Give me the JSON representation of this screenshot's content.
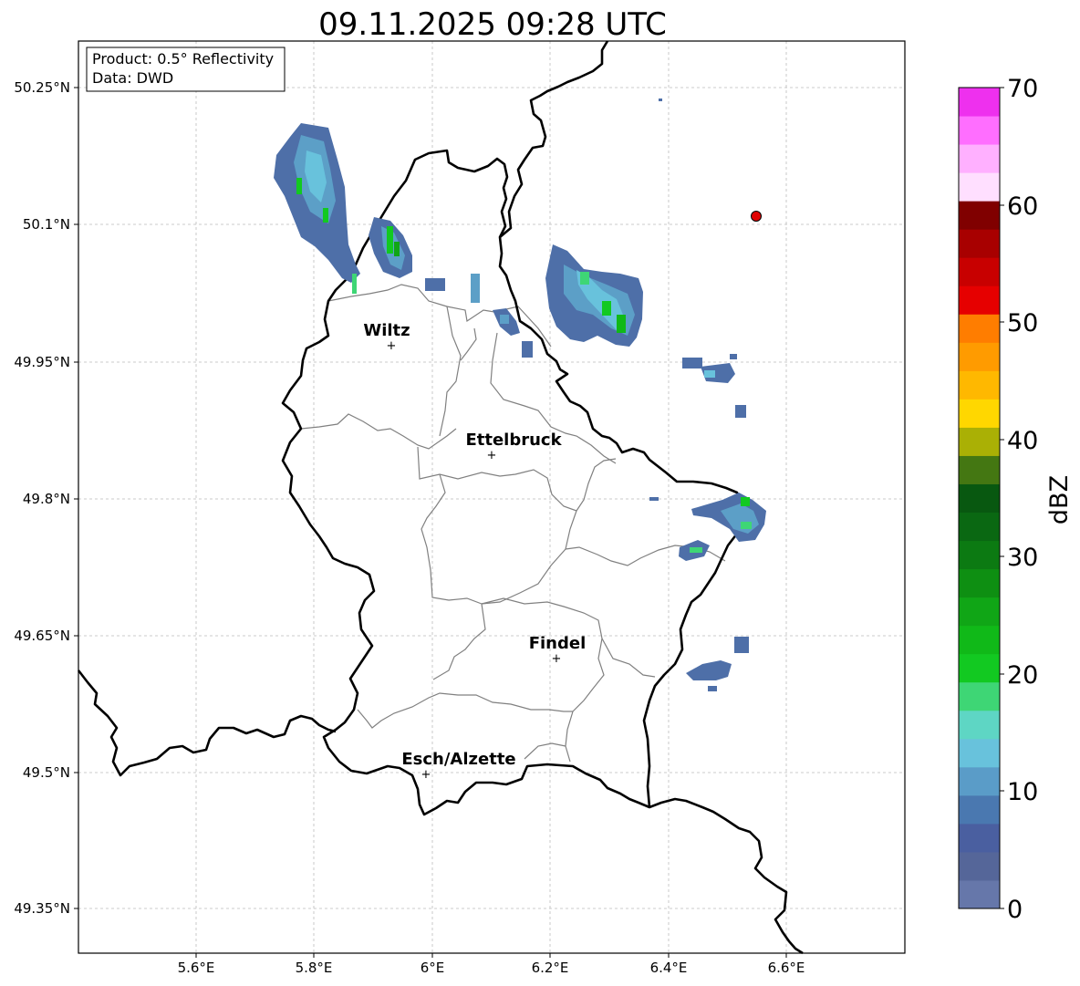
{
  "title": "09.11.2025 09:28 UTC",
  "info": {
    "product": "Product: 0.5° Reflectivity",
    "data": "Data: DWD"
  },
  "axes": {
    "x_ticks": [
      "5.6°E",
      "5.8°E",
      "6°E",
      "6.2°E",
      "6.4°E",
      "6.6°E"
    ],
    "y_ticks": [
      "50.25°N",
      "50.1°N",
      "49.95°N",
      "49.8°N",
      "49.65°N",
      "49.5°N",
      "49.35°N"
    ]
  },
  "cities": [
    {
      "name": "Wiltz"
    },
    {
      "name": "Ettelbruck"
    },
    {
      "name": "Findel"
    },
    {
      "name": "Esch/Alzette"
    }
  ],
  "colorbar": {
    "label": "dBZ",
    "ticks": [
      "0",
      "10",
      "20",
      "30",
      "40",
      "50",
      "60",
      "70"
    ],
    "colors": [
      "#6677aa",
      "#556699",
      "#4a5fa0",
      "#4a78b0",
      "#5a9cc8",
      "#68c2dc",
      "#5ed6c4",
      "#3ed675",
      "#12c921",
      "#10b918",
      "#10a616",
      "#0e8f12",
      "#0c7a12",
      "#0a6812",
      "#085810",
      "#447712",
      "#aab005",
      "#ffd700",
      "#ffb800",
      "#ff9b00",
      "#ff7d00",
      "#e60000",
      "#c80000",
      "#a80000",
      "#800000",
      "#ffdfff",
      "#ffb0ff",
      "#ff6eff",
      "#ee30ee"
    ]
  },
  "marker_color": "#e00000"
}
